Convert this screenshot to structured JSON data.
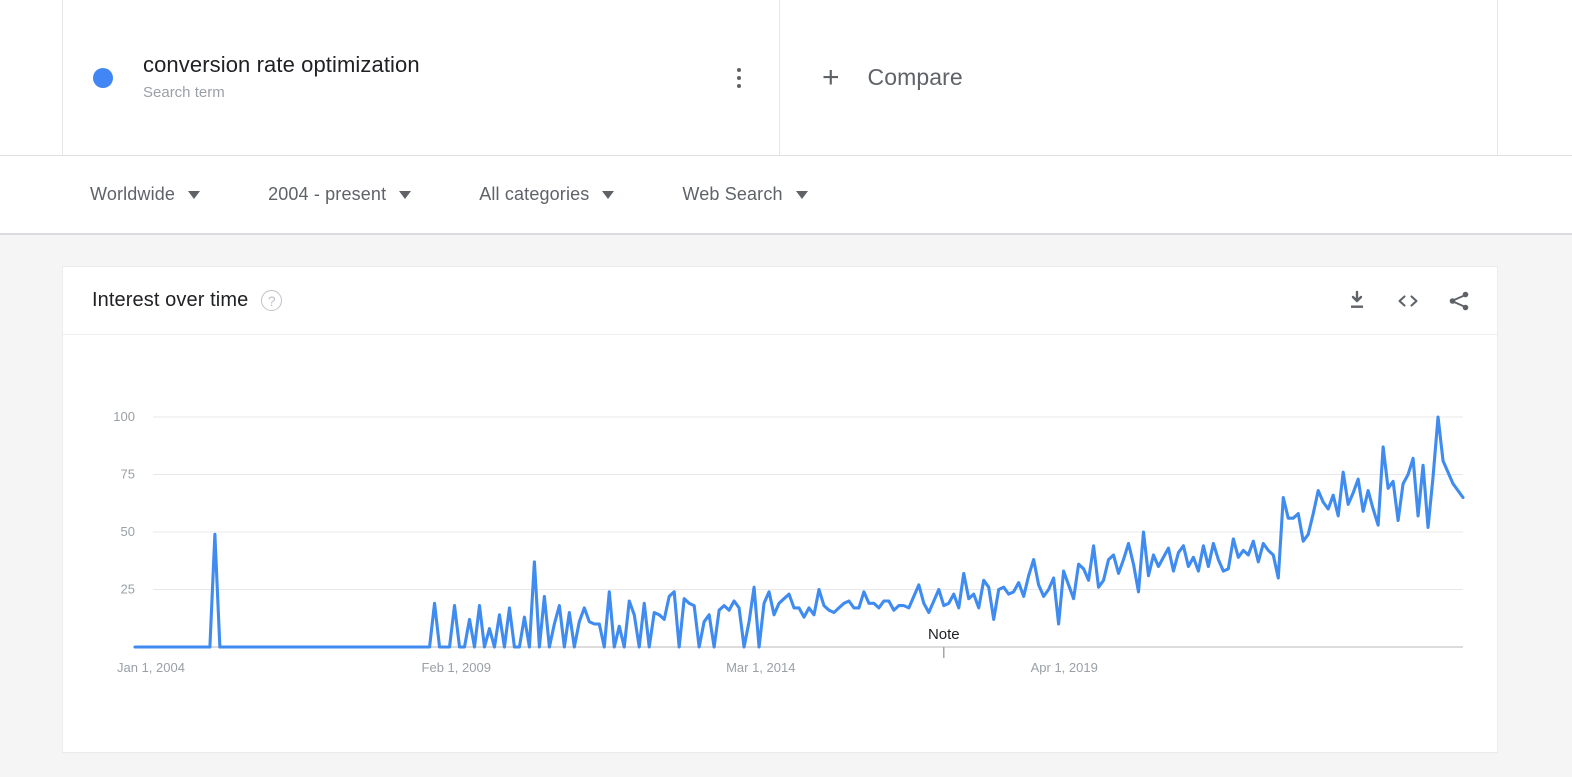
{
  "search_term": {
    "title": "conversion rate optimization",
    "subtitle": "Search term",
    "dot_color": "#4285f4",
    "menu_icon": "more-vert-icon"
  },
  "compare": {
    "label": "Compare",
    "plus": "+"
  },
  "filters": [
    {
      "label": "Worldwide"
    },
    {
      "label": "2004 - present"
    },
    {
      "label": "All categories"
    },
    {
      "label": "Web Search"
    }
  ],
  "card": {
    "title": "Interest over time",
    "help_icon": "?",
    "tools": [
      {
        "name": "download-icon"
      },
      {
        "name": "embed-code-icon"
      },
      {
        "name": "share-icon"
      }
    ]
  },
  "chart_data": {
    "type": "line",
    "title": "Interest over time",
    "xlabel": "",
    "ylabel": "",
    "ylim": [
      0,
      100
    ],
    "grid": true,
    "legend_position": "top",
    "series_color": "#3f8bf0",
    "series": [
      {
        "name": "conversion rate optimization",
        "values": [
          0,
          0,
          0,
          0,
          0,
          0,
          0,
          0,
          0,
          0,
          0,
          0,
          0,
          0,
          0,
          0,
          49,
          0,
          0,
          0,
          0,
          0,
          0,
          0,
          0,
          0,
          0,
          0,
          0,
          0,
          0,
          0,
          0,
          0,
          0,
          0,
          0,
          0,
          0,
          0,
          0,
          0,
          0,
          0,
          0,
          0,
          0,
          0,
          0,
          0,
          0,
          0,
          0,
          0,
          0,
          0,
          0,
          0,
          0,
          0,
          19,
          0,
          0,
          0,
          18,
          0,
          0,
          12,
          0,
          18,
          0,
          8,
          0,
          14,
          0,
          17,
          0,
          0,
          13,
          0,
          37,
          0,
          22,
          0,
          10,
          18,
          0,
          15,
          0,
          11,
          17,
          11,
          10,
          10,
          0,
          24,
          0,
          9,
          0,
          20,
          14,
          0,
          19,
          0,
          15,
          14,
          12,
          22,
          24,
          0,
          21,
          19,
          18,
          0,
          11,
          14,
          0,
          16,
          18,
          16,
          20,
          17,
          0,
          11,
          26,
          0,
          19,
          24,
          14,
          19,
          21,
          23,
          17,
          17,
          13,
          17,
          14,
          25,
          18,
          16,
          15,
          17,
          19,
          20,
          17,
          17,
          24,
          19,
          19,
          17,
          20,
          20,
          16,
          18,
          18,
          17,
          22,
          27,
          19,
          15,
          20,
          25,
          18,
          19,
          23,
          17,
          32,
          21,
          23,
          17,
          29,
          26,
          12,
          25,
          26,
          23,
          24,
          28,
          22,
          31,
          38,
          27,
          22,
          25,
          30,
          10,
          33,
          27,
          21,
          36,
          34,
          29,
          44,
          26,
          29,
          38,
          40,
          32,
          38,
          45,
          36,
          24,
          50,
          31,
          40,
          35,
          39,
          43,
          33,
          41,
          44,
          35,
          39,
          33,
          44,
          35,
          45,
          38,
          33,
          34,
          47,
          39,
          42,
          40,
          46,
          37,
          45,
          42,
          40,
          30,
          65,
          56,
          56,
          58,
          46,
          49,
          58,
          68,
          63,
          60,
          66,
          57,
          76,
          62,
          67,
          73,
          59,
          68,
          60,
          53,
          87,
          69,
          72,
          55,
          71,
          75,
          82,
          57,
          79,
          52,
          74,
          100,
          81,
          76,
          71,
          68,
          65
        ]
      }
    ],
    "y_ticks": [
      100,
      75,
      50,
      25
    ],
    "x_ticks": [
      {
        "label": "Jan 1, 2004",
        "index": 0
      },
      {
        "label": "Feb 1, 2009",
        "index": 61
      },
      {
        "label": "Mar 1, 2014",
        "index": 122
      },
      {
        "label": "Apr 1, 2019",
        "index": 183
      }
    ],
    "annotations": [
      {
        "label": "Note",
        "index": 162
      }
    ]
  }
}
